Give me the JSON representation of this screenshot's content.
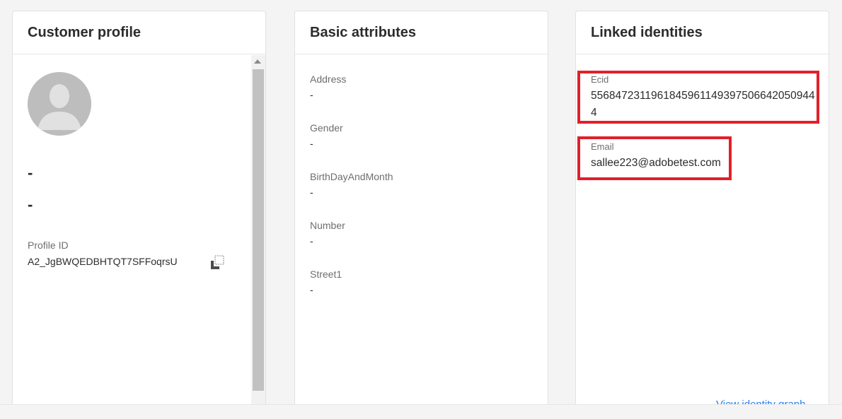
{
  "profile_card": {
    "title": "Customer profile",
    "name_line1": "-",
    "name_line2": "-",
    "profile_id_label": "Profile ID",
    "profile_id_value": "A2_JgBWQEDBHTQT7SFFoqrsU"
  },
  "attributes_card": {
    "title": "Basic attributes",
    "attributes": [
      {
        "label": "Address",
        "value": "-"
      },
      {
        "label": "Gender",
        "value": "-"
      },
      {
        "label": "BirthDayAndMonth",
        "value": "-"
      },
      {
        "label": "Number",
        "value": "-"
      },
      {
        "label": "Street1",
        "value": "-"
      }
    ]
  },
  "identities_card": {
    "title": "Linked identities",
    "identities": [
      {
        "label": "Ecid",
        "value": "55684723119618459611493975066420509444"
      },
      {
        "label": "Email",
        "value": "sallee223@adobetest.com"
      }
    ],
    "view_graph_link": "View identity graph"
  },
  "colors": {
    "highlight": "#e0202a",
    "link": "#2680eb"
  }
}
